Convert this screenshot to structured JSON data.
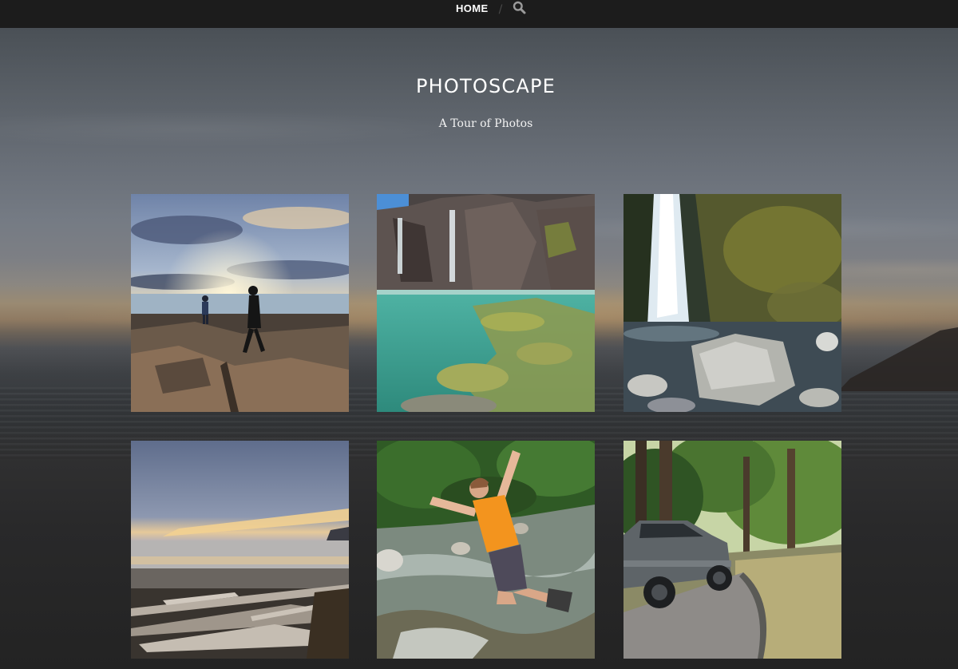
{
  "nav": {
    "home_label": "HOME",
    "separator": "/",
    "search_icon": "search-icon"
  },
  "site": {
    "title": "PHOTOSCAPE",
    "tagline": "A Tour of Photos"
  },
  "gallery": {
    "tiles": [
      {
        "depicts": "sunset-beach-silhouettes"
      },
      {
        "depicts": "clear-pool-waterfall"
      },
      {
        "depicts": "forest-waterfall-boulder"
      },
      {
        "depicts": "driftwood-beach-sunset"
      },
      {
        "depicts": "boy-playing-in-creek"
      },
      {
        "depicts": "parked-suv-forest-trail"
      }
    ]
  },
  "colors": {
    "nav_bg": "#1c1c1c",
    "nav_text": "#ffffff",
    "title_text": "#ffffff"
  }
}
